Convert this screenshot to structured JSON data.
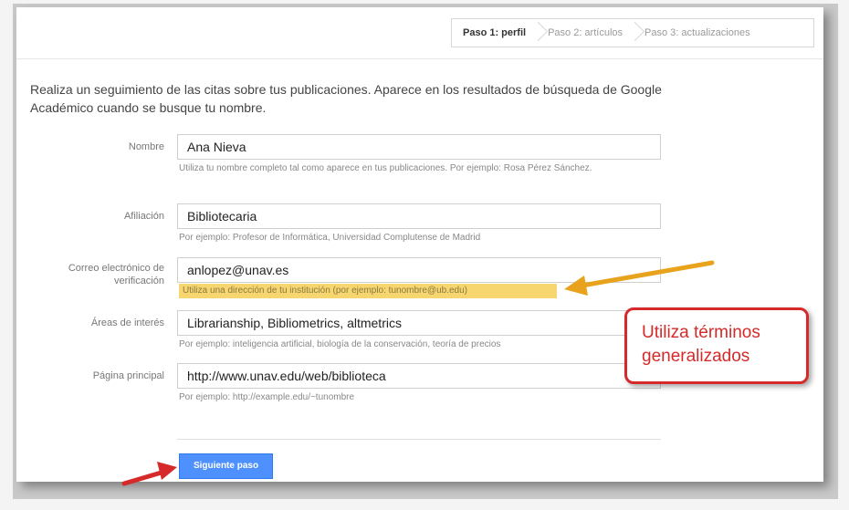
{
  "steps": [
    {
      "label": "Paso 1: perfil",
      "active": true
    },
    {
      "label": "Paso 2: artículos",
      "active": false
    },
    {
      "label": "Paso 3: actualizaciones",
      "active": false
    }
  ],
  "intro": "Realiza un seguimiento de las citas sobre tus publicaciones. Aparece en los resultados de búsqueda de Google Académico cuando se busque tu nombre.",
  "form": {
    "name": {
      "label": "Nombre",
      "value": "Ana Nieva",
      "hint": "Utiliza tu nombre completo tal como aparece en tus publicaciones. Por ejemplo: Rosa Pérez Sánchez."
    },
    "affiliation": {
      "label": "Afiliación",
      "value": "Bibliotecaria",
      "hint": "Por ejemplo: Profesor de Informática, Universidad Complutense de Madrid"
    },
    "email": {
      "label": "Correo electrónico de verificación",
      "value": "anlopez@unav.es",
      "hint": "Utiliza una dirección de tu institución (por ejemplo: tunombre@ub.edu)"
    },
    "interests": {
      "label": "Áreas de interés",
      "value": "Librarianship, Bibliometrics, altmetrics",
      "hint": "Por ejemplo: inteligencia artificial, biología de la conservación, teoría de precios"
    },
    "homepage": {
      "label": "Página principal",
      "value": "http://www.unav.edu/web/biblioteca",
      "hint": "Por ejemplo: http://example.edu/~tunombre"
    }
  },
  "next_button": "Siguiente paso",
  "callout": "Utiliza términos generalizados",
  "colors": {
    "accent_blue": "#4d90fe",
    "highlight": "#f7d56f",
    "annotation_red": "#d62a2a",
    "arrow_orange": "#e8a21c"
  }
}
